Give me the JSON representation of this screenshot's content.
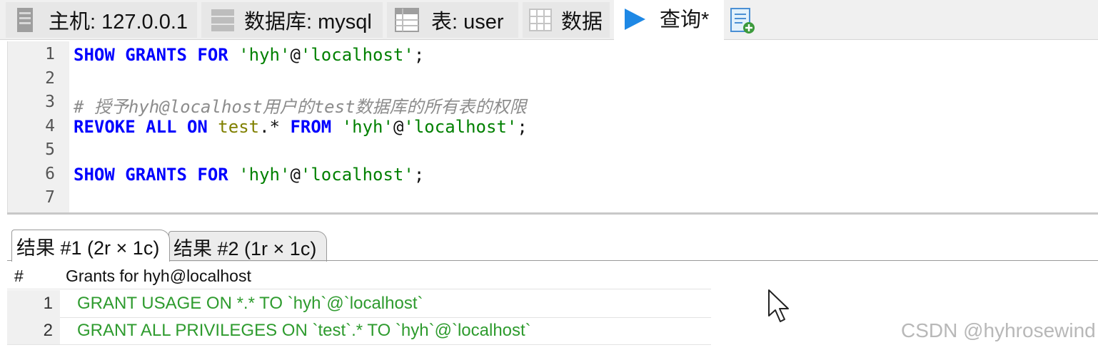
{
  "tabs": [
    {
      "label": "主机: 127.0.0.1",
      "icon": "server-icon"
    },
    {
      "label": "数据库: mysql",
      "icon": "database-icon"
    },
    {
      "label": "表: user",
      "icon": "table-icon"
    },
    {
      "label": "数据",
      "icon": "grid-icon"
    },
    {
      "label": "查询*",
      "icon": "play-icon"
    },
    {
      "label": "",
      "icon": "new-query-icon"
    }
  ],
  "editor": {
    "line_numbers": [
      "1",
      "2",
      "3",
      "4",
      "5",
      "6",
      "7"
    ],
    "lines": [
      [
        {
          "t": "SHOW GRANTS FOR ",
          "c": "kw"
        },
        {
          "t": "'hyh'",
          "c": "str"
        },
        {
          "t": "@",
          "c": "plain"
        },
        {
          "t": "'localhost'",
          "c": "str"
        },
        {
          "t": ";",
          "c": "plain"
        }
      ],
      [],
      [
        {
          "t": "# 授予hyh@localhost用户的test数据库的所有表的权限",
          "c": "cmt"
        }
      ],
      [
        {
          "t": "REVOKE ALL ON ",
          "c": "kw"
        },
        {
          "t": "test",
          "c": "obj"
        },
        {
          "t": ".* ",
          "c": "plain"
        },
        {
          "t": "FROM ",
          "c": "kw"
        },
        {
          "t": "'hyh'",
          "c": "str"
        },
        {
          "t": "@",
          "c": "plain"
        },
        {
          "t": "'localhost'",
          "c": "str"
        },
        {
          "t": ";",
          "c": "plain"
        }
      ],
      [],
      [
        {
          "t": "SHOW GRANTS FOR ",
          "c": "kw"
        },
        {
          "t": "'hyh'",
          "c": "str"
        },
        {
          "t": "@",
          "c": "plain"
        },
        {
          "t": "'localhost'",
          "c": "str"
        },
        {
          "t": ";",
          "c": "plain"
        }
      ],
      []
    ]
  },
  "results": {
    "tabs": [
      "结果 #1 (2r × 1c)",
      "结果 #2 (1r × 1c)"
    ],
    "header_hash": "#",
    "column": "Grants for hyh@localhost",
    "rows": [
      {
        "num": "1",
        "value": "GRANT USAGE ON *.* TO `hyh`@`localhost`"
      },
      {
        "num": "2",
        "value": "GRANT ALL PRIVILEGES ON `test`.* TO `hyh`@`localhost`"
      }
    ]
  },
  "watermark": "CSDN @hyhrosewind",
  "colors": {
    "keyword": "#0000ff",
    "string": "#008000",
    "comment": "#8c8c8c",
    "result_text": "#2e9b2e",
    "play": "#1e88e5"
  }
}
